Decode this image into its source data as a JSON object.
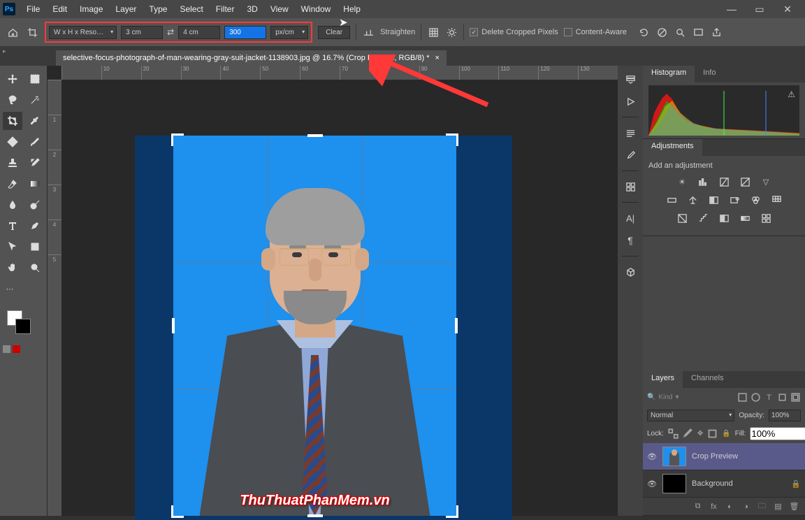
{
  "menu": [
    "File",
    "Edit",
    "Image",
    "Layer",
    "Type",
    "Select",
    "Filter",
    "3D",
    "View",
    "Window",
    "Help"
  ],
  "options": {
    "preset": "W x H x Reso…",
    "width": "3 cm",
    "height": "4 cm",
    "resolution": "300",
    "unit": "px/cm",
    "clear": "Clear",
    "straighten": "Straighten",
    "delete_cropped": "Delete Cropped Pixels",
    "content_aware": "Content-Aware"
  },
  "doc": {
    "title": "selective-focus-photograph-of-man-wearing-gray-suit-jacket-1138903.jpg @ 16.7% (Crop Preview, RGB/8) *"
  },
  "ruler_marks_h": [
    "",
    "10",
    "20",
    "30",
    "40",
    "50",
    "60",
    "70",
    "80",
    "90",
    "100",
    "110",
    "120",
    "130"
  ],
  "ruler_marks_v": [
    "",
    "1",
    "2",
    "3",
    "4",
    "5"
  ],
  "watermark": "ThuThuatPhanMem.vn",
  "panels": {
    "histogram_tab": "Histogram",
    "info_tab": "Info",
    "adjustments_tab": "Adjustments",
    "add_adj": "Add an adjustment",
    "layers_tab": "Layers",
    "channels_tab": "Channels",
    "kind": "Kind",
    "normal": "Normal",
    "opacity_lbl": "Opacity:",
    "opacity_val": "100%",
    "lock_lbl": "Lock:",
    "fill_lbl": "Fill:",
    "fill_val": "100%",
    "layer1": "Crop Preview",
    "layer2": "Background"
  },
  "search_placeholder": ""
}
